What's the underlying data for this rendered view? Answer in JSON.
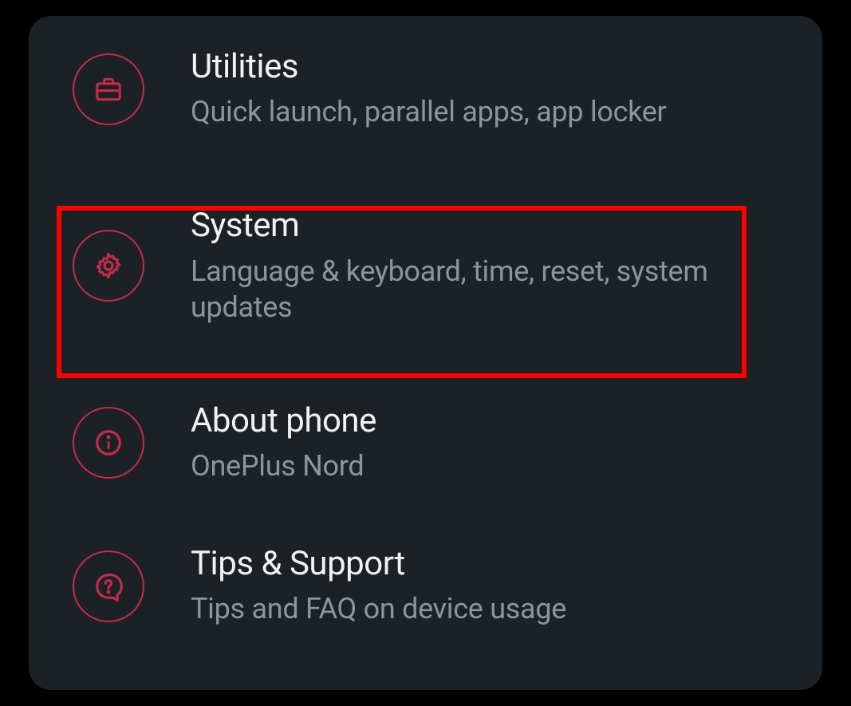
{
  "settings": {
    "items": [
      {
        "title": "Utilities",
        "subtitle": "Quick launch, parallel apps, app locker",
        "icon": "briefcase-icon"
      },
      {
        "title": "System",
        "subtitle": "Language & keyboard, time, reset, system updates",
        "icon": "gear-icon"
      },
      {
        "title": "About phone",
        "subtitle": "OnePlus Nord",
        "icon": "info-icon"
      },
      {
        "title": "Tips & Support",
        "subtitle": "Tips and FAQ on device usage",
        "icon": "help-icon"
      }
    ]
  },
  "highlight_index": 1,
  "colors": {
    "accent": "#c32b4b",
    "background": "#1c2125",
    "title_text": "#f2f2f4",
    "subtitle_text": "#8f949a",
    "highlight": "#ff0000"
  }
}
